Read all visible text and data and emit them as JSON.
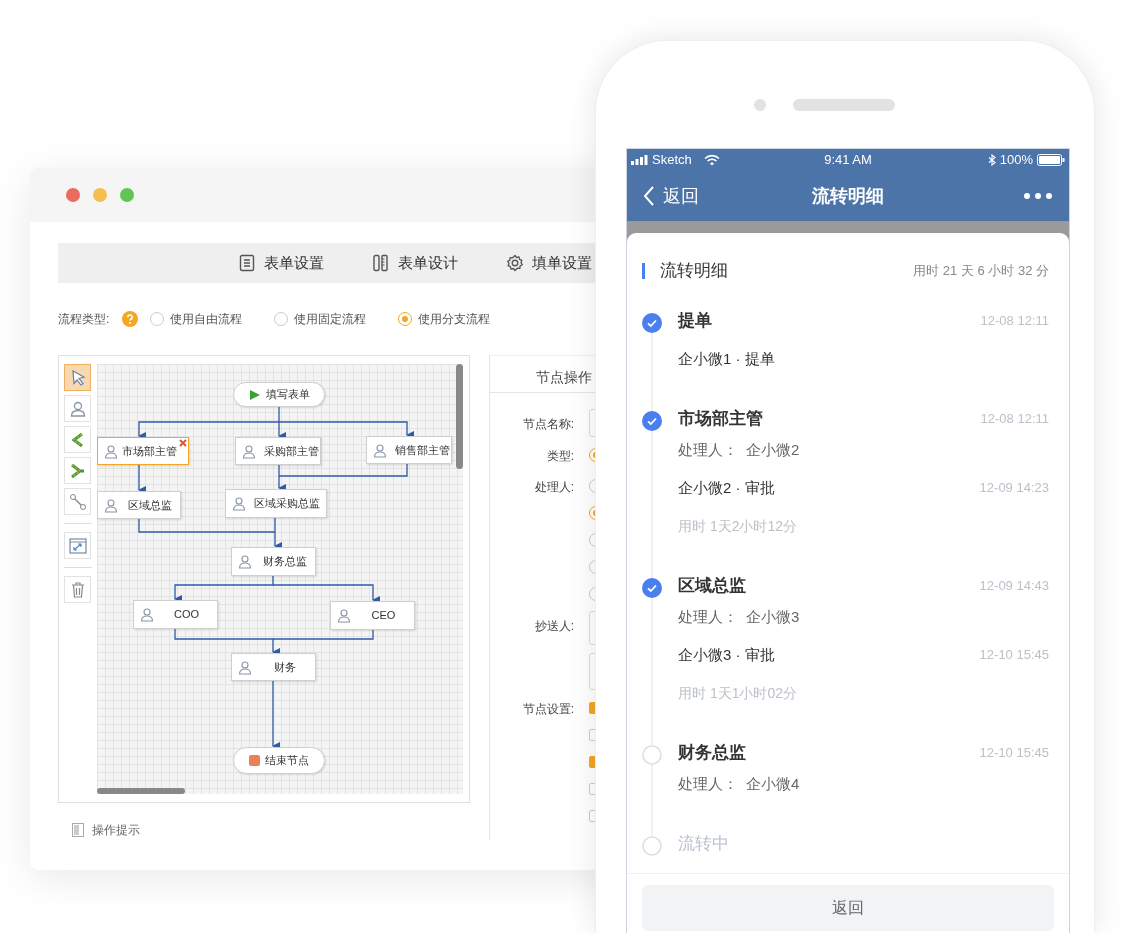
{
  "desktop": {
    "tabs": [
      {
        "kind": "doc",
        "label": "表单设置"
      },
      {
        "kind": "ruler",
        "label": "表单设计"
      },
      {
        "kind": "gear",
        "label": "填单设置"
      }
    ],
    "flow_type": {
      "label": "流程类型:",
      "options": [
        {
          "label": "使用自由流程",
          "selected": false
        },
        {
          "label": "使用固定流程",
          "selected": false
        },
        {
          "label": "使用分支流程",
          "selected": true
        }
      ]
    },
    "tools": [
      {
        "kind": "pointer",
        "selected": true
      },
      {
        "kind": "person",
        "selected": false
      },
      {
        "kind": "branch",
        "selected": false
      },
      {
        "kind": "merge",
        "selected": false
      },
      {
        "kind": "connector",
        "selected": false
      },
      {
        "kind": "fit",
        "selected": false
      },
      {
        "kind": "trash",
        "selected": false
      }
    ],
    "flow_nodes": [
      {
        "kind": "start",
        "label": "填写表单",
        "selected": false
      },
      {
        "kind": "task",
        "label": "市场部主管",
        "selected": true
      },
      {
        "kind": "task",
        "label": "采购部主管",
        "selected": false
      },
      {
        "kind": "task",
        "label": "销售部主管",
        "selected": false
      },
      {
        "kind": "task",
        "label": "区域总监",
        "selected": false
      },
      {
        "kind": "task",
        "label": "区域采购总监",
        "selected": false
      },
      {
        "kind": "task",
        "label": "财务总监",
        "selected": false
      },
      {
        "kind": "task",
        "label": "COO",
        "selected": false
      },
      {
        "kind": "task",
        "label": "CEO",
        "selected": false
      },
      {
        "kind": "task",
        "label": "财务",
        "selected": false
      },
      {
        "kind": "end",
        "label": "结束节点",
        "selected": false
      }
    ],
    "hint": "操作提示",
    "node_panel": {
      "title": "节点操作",
      "fields": [
        {
          "kind": "input",
          "label": "节点名称:"
        },
        {
          "kind": "radios",
          "label": "类型:",
          "options": [
            {
              "selected": true
            }
          ]
        },
        {
          "kind": "radios",
          "label": "处理人:",
          "options": [
            {
              "selected": false
            },
            {
              "selected": true
            },
            {
              "selected": false
            },
            {
              "selected": false
            },
            {
              "selected": false
            }
          ]
        },
        {
          "kind": "inputs",
          "label": "抄送人:"
        },
        {
          "kind": "checks",
          "label": "节点设置:",
          "options": [
            {
              "checked": true
            },
            {
              "checked": false
            },
            {
              "checked": true
            },
            {
              "checked": false
            },
            {
              "checked": false
            }
          ]
        }
      ]
    }
  },
  "phone": {
    "status_bar": {
      "carrier": "Sketch",
      "time": "9:41 AM",
      "battery": "100%"
    },
    "nav": {
      "back": "返回",
      "title": "流转明细"
    },
    "header": {
      "title": "流转明细",
      "elapsed": "用时 21 天 6 小时 32 分"
    },
    "steps": [
      {
        "kind": "step",
        "done": true,
        "title": "提单",
        "time": "12-08 12:11",
        "actions": [
          {
            "text": "企小微1 · 提单"
          }
        ]
      },
      {
        "kind": "step",
        "done": true,
        "title": "市场部主管",
        "time": "12-08 12:11",
        "handler_label": "处理人：",
        "handler": "企小微2",
        "actions": [
          {
            "text": "企小微2 · 审批",
            "time": "12-09 14:23"
          }
        ],
        "duration": "用时 1天2小时12分"
      },
      {
        "kind": "step",
        "done": true,
        "title": "区域总监",
        "time": "12-09 14:43",
        "handler_label": "处理人：",
        "handler": "企小微3",
        "actions": [
          {
            "text": "企小微3 · 审批",
            "time": "12-10 15:45"
          }
        ],
        "duration": "用时 1天1小时02分"
      },
      {
        "kind": "step",
        "done": false,
        "title": "财务总监",
        "time": "12-10 15:45",
        "handler_label": "处理人：",
        "handler": "企小微4"
      },
      {
        "kind": "current",
        "done": false,
        "title": "流转中"
      }
    ],
    "footer_button": "返回"
  }
}
